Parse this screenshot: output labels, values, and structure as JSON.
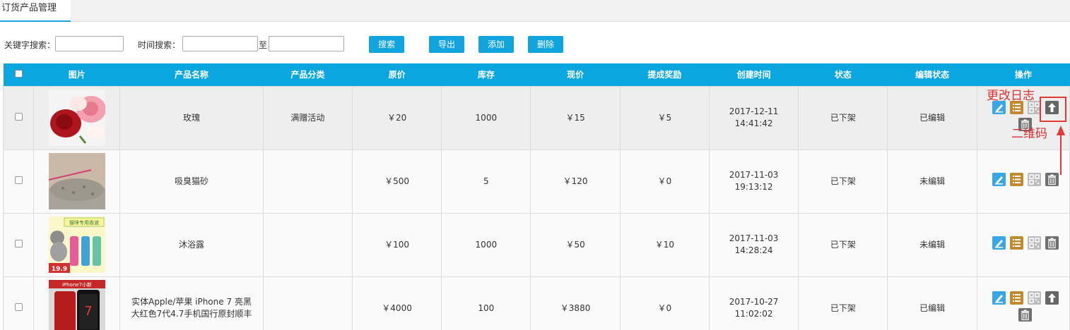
{
  "tab": {
    "title": "订货产品管理"
  },
  "search": {
    "keyword_label": "关键字搜索：",
    "keyword_value": "",
    "time_label": "时间搜索：",
    "time_from": "",
    "to_label": "至",
    "time_to": "",
    "search_btn": "搜索",
    "export_btn": "导出",
    "add_btn": "添加",
    "delete_btn": "删除"
  },
  "table": {
    "headers": [
      "图片",
      "产品名称",
      "产品分类",
      "原价",
      "库存",
      "现价",
      "提成奖励",
      "创建时间",
      "状态",
      "编辑状态",
      "操作"
    ],
    "rows": [
      {
        "name": "玫瑰",
        "category": "满赠活动",
        "orig": "￥20",
        "stock": "1000",
        "price": "￥15",
        "reward": "￥5",
        "created": "2017-12-11 14:41:42",
        "status": "已下架",
        "edit": "已编辑",
        "thumb": "rose"
      },
      {
        "name": "吸臭猫砂",
        "category": "",
        "orig": "￥500",
        "stock": "5",
        "price": "￥120",
        "reward": "￥0",
        "created": "2017-11-03 19:13:12",
        "status": "已下架",
        "edit": "未编辑",
        "thumb": "litter"
      },
      {
        "name": "沐浴露",
        "category": "",
        "orig": "￥100",
        "stock": "1000",
        "price": "￥50",
        "reward": "￥10",
        "created": "2017-11-03 14:28:24",
        "status": "已下架",
        "edit": "未编辑",
        "thumb": "shampoo"
      },
      {
        "name": "实体Apple/苹果 iPhone 7 亮黑大红色7代4.7手机国行原封顺丰",
        "category": "",
        "orig": "￥4000",
        "stock": "100",
        "price": "￥3880",
        "reward": "￥0",
        "created": "2017-10-27 11:02:02",
        "status": "已下架",
        "edit": "已编辑",
        "thumb": "iphone"
      }
    ]
  },
  "thumb_text": {
    "shampoo_title": "猫咪专用香波",
    "shampoo_price": "19.9",
    "iphone_top": "iPhone7小新"
  },
  "annotations": {
    "log": "更改日志",
    "qr": "二维码"
  },
  "colors": {
    "header": "#0aa6df",
    "button": "#10a5de",
    "annotation": "#e53935"
  }
}
